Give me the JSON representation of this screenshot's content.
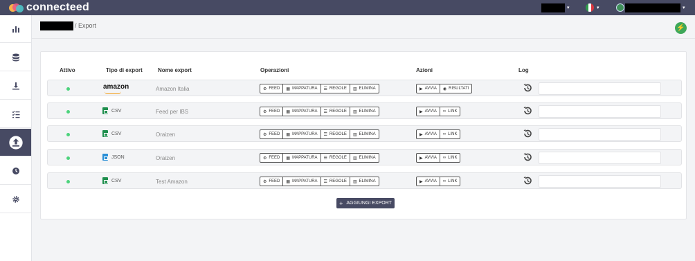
{
  "app": {
    "name": "connecteed"
  },
  "breadcrumb": {
    "current": "/ Export"
  },
  "table": {
    "headers": [
      "Attivo",
      "Tipo di export",
      "Nome export",
      "Operazioni",
      "Azioni",
      "Log"
    ],
    "rows": [
      {
        "type": "amazon",
        "type_label": "amazon",
        "name": "Amazon Italia",
        "ops": [
          "FEED",
          "MAPPATURA",
          "REGOLE",
          "ELIMINA"
        ],
        "actions": [
          "AVVIA",
          "RISULTATI"
        ]
      },
      {
        "type": "csv",
        "type_label": "CSV",
        "name": "Feed per IBS",
        "ops": [
          "FEED",
          "MAPPATURA",
          "REGOLE",
          "ELIMINA"
        ],
        "actions": [
          "AVVIA",
          "LINK"
        ]
      },
      {
        "type": "csv",
        "type_label": "CSV",
        "name": "Oraizen",
        "ops": [
          "FEED",
          "MAPPATURA",
          "REGOLE",
          "ELIMINA"
        ],
        "actions": [
          "AVVIA",
          "LINK"
        ]
      },
      {
        "type": "json",
        "type_label": "JSON",
        "name": "Oraizen",
        "ops": [
          "FEED",
          "MAPPATURA",
          "REGOLE",
          "ELIMINA"
        ],
        "actions": [
          "AVVIA",
          "LINK"
        ]
      },
      {
        "type": "csv",
        "type_label": "CSV",
        "name": "Test Amazon",
        "ops": [
          "FEED",
          "MAPPATURA",
          "REGOLE",
          "ELIMINA"
        ],
        "actions": [
          "AVVIA",
          "LINK"
        ]
      }
    ]
  },
  "add_button": {
    "label": "AGGIUNGI EXPORT"
  },
  "colors": {
    "primary": "#474a63",
    "active_dot": "#4cd37c",
    "bolt": "#3ea85a"
  },
  "sidebar": {
    "icons": [
      "chart-icon",
      "database-icon",
      "download-icon",
      "checklist-icon",
      "upload-icon",
      "clock-icon",
      "gear-icon"
    ],
    "active": "upload-icon"
  }
}
